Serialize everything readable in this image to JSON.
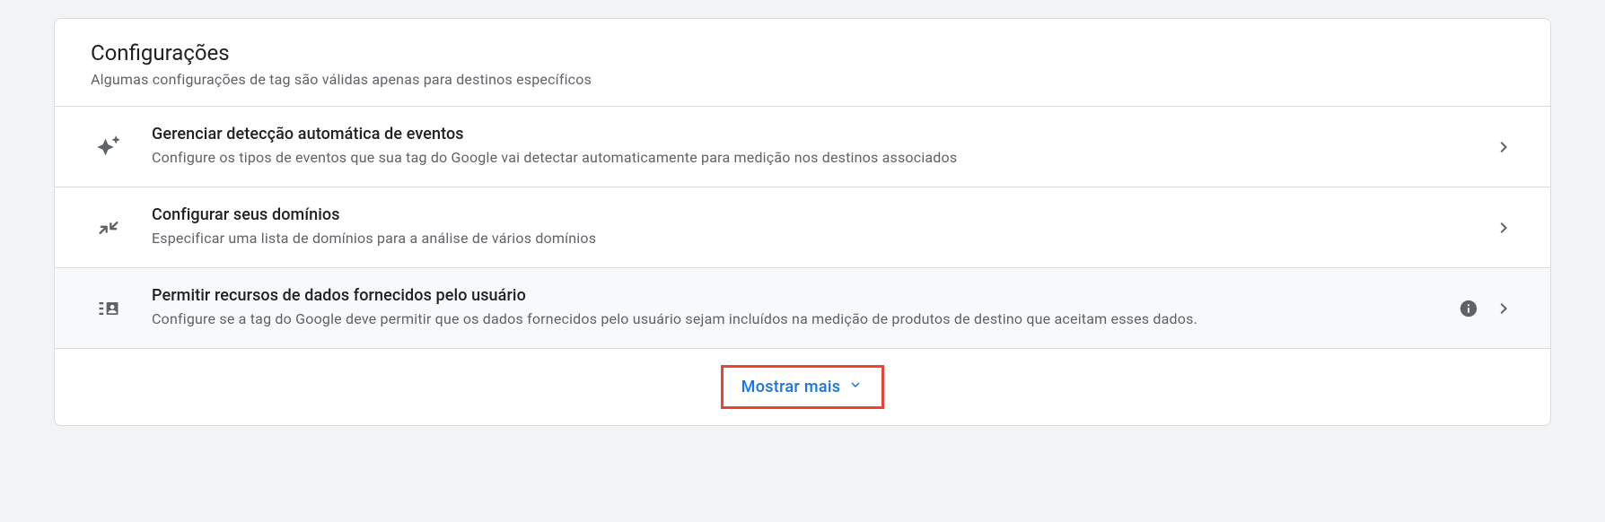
{
  "header": {
    "title": "Configurações",
    "subtitle": "Algumas configurações de tag são válidas apenas para destinos específicos"
  },
  "settings": [
    {
      "icon": "sparkle",
      "title": "Gerenciar detecção automática de eventos",
      "description": "Configure os tipos de eventos que sua tag do Google vai detectar automaticamente para medição nos destinos associados",
      "hasInfo": false,
      "highlighted": false
    },
    {
      "icon": "arrows-in",
      "title": "Configurar seus domínios",
      "description": "Especificar uma lista de domínios para a análise de vários domínios",
      "hasInfo": false,
      "highlighted": false
    },
    {
      "icon": "user-data",
      "title": "Permitir recursos de dados fornecidos pelo usuário",
      "description": "Configure se a tag do Google deve permitir que os dados fornecidos pelo usuário sejam incluídos na medição de produtos de destino que aceitam esses dados.",
      "hasInfo": true,
      "highlighted": true
    }
  ],
  "showMore": {
    "label": "Mostrar mais"
  }
}
